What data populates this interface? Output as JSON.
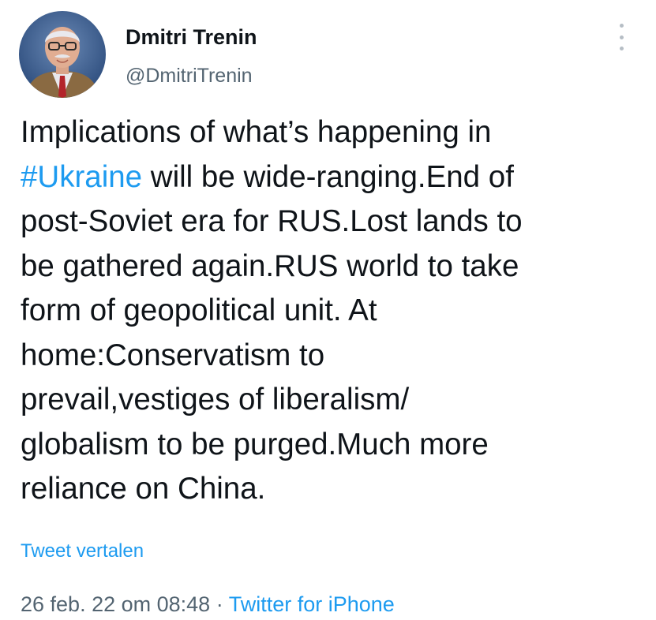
{
  "author": {
    "display_name": "Dmitri Trenin",
    "handle": "@DmitriTrenin",
    "avatar_icon": "profile-photo"
  },
  "tweet": {
    "lines": [
      [
        "Implications of what’s happening in"
      ],
      [
        "#Ukraine",
        " will be wide-ranging.End of"
      ],
      [
        "post-Soviet era for RUS.Lost lands to"
      ],
      [
        "be gathered again.RUS world to take"
      ],
      [
        "form of geopolitical unit. At"
      ],
      [
        "home:Conservatism to"
      ],
      [
        "prevail,vestiges of liberalism/"
      ],
      [
        "globalism to be purged.Much more"
      ],
      [
        "reliance on China."
      ]
    ],
    "hashtag": "#Ukraine",
    "translate_label": "Tweet vertalen"
  },
  "meta": {
    "timestamp": "26 feb. 22 om 08:48",
    "separator": " · ",
    "source": "Twitter for iPhone"
  },
  "colors": {
    "link": "#1d9bf0",
    "secondary_text": "#536471",
    "primary_text": "#0f1419"
  },
  "icons": {
    "more": "more-vertical-icon"
  }
}
